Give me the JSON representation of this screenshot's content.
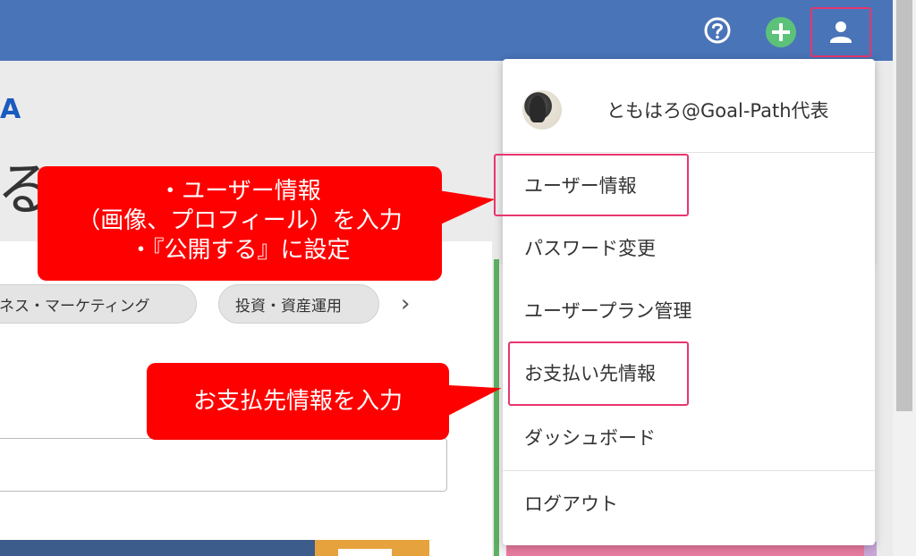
{
  "header": {
    "help_icon": "question-circle-icon",
    "add_icon": "plus-circle-icon",
    "user_icon": "person-icon",
    "accent_color": "#4a74b8",
    "add_color": "#5cc27a",
    "highlight_color": "#e8366e"
  },
  "background": {
    "logo_fragment": "A",
    "big_char": "る",
    "chips": [
      "ネス・マーケティング",
      "投資・資産運用"
    ],
    "chevron": "›"
  },
  "callouts": {
    "top_line1": "・ユーザー情報",
    "top_line2": "（画像、プロフィール）を入力",
    "top_line3": "・『公開する』に設定",
    "bottom": "お支払先情報を入力",
    "color": "#ff0000"
  },
  "dropdown": {
    "profile_name": "ともはろ@Goal-Path代表",
    "items": [
      {
        "label": "ユーザー情報"
      },
      {
        "label": "パスワード変更"
      },
      {
        "label": "ユーザープラン管理"
      },
      {
        "label": "お支払い先情報"
      },
      {
        "label": "ダッシュボード"
      },
      {
        "label": "ログアウト"
      }
    ]
  }
}
